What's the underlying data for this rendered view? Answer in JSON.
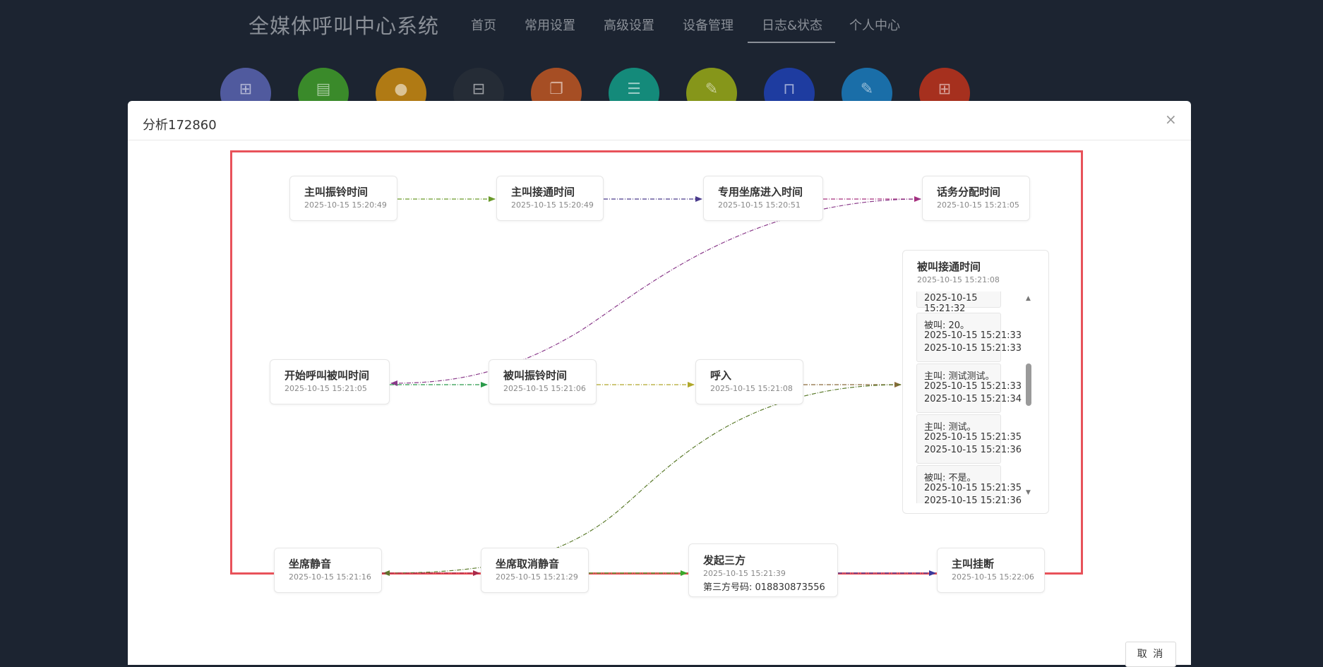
{
  "app": {
    "title": "全媒体呼叫中心系统",
    "nav": [
      "首页",
      "常用设置",
      "高级设置",
      "设备管理",
      "日志&状态",
      "个人中心"
    ],
    "active_nav": "日志&状态"
  },
  "quick_icons": [
    {
      "name": "stats-icon",
      "color": "#505a9e",
      "glyph": "⊞"
    },
    {
      "name": "document-icon",
      "color": "#3a8a2a",
      "glyph": "▤"
    },
    {
      "name": "user-icon",
      "color": "#b07a14",
      "glyph": "●"
    },
    {
      "name": "monitor-icon",
      "color": "#252c36",
      "glyph": "⊟"
    },
    {
      "name": "files-icon",
      "color": "#a64e24",
      "glyph": "❐"
    },
    {
      "name": "sliders-icon",
      "color": "#148a7a",
      "glyph": "☰"
    },
    {
      "name": "edit-icon",
      "color": "#86961a",
      "glyph": "✎"
    },
    {
      "name": "presentation-icon",
      "color": "#1e3ca0",
      "glyph": "⊓"
    },
    {
      "name": "write-icon",
      "color": "#1a6ea8",
      "glyph": "✎"
    },
    {
      "name": "report-icon",
      "color": "#a6301e",
      "glyph": "⊞"
    }
  ],
  "modal": {
    "title": "分析172860",
    "close_symbol": "×",
    "cancel_label": "取 消"
  },
  "flow": {
    "nodes": {
      "caller_ring": {
        "title": "主叫振铃时间",
        "time": "2025-10-15 15:20:49"
      },
      "caller_answer": {
        "title": "主叫接通时间",
        "time": "2025-10-15 15:20:49"
      },
      "agent_enter": {
        "title": "专用坐席进入时间",
        "time": "2025-10-15 15:20:51"
      },
      "dispatch": {
        "title": "话务分配时间",
        "time": "2025-10-15 15:21:05"
      },
      "start_callee": {
        "title": "开始呼叫被叫时间",
        "time": "2025-10-15 15:21:05"
      },
      "callee_ring": {
        "title": "被叫振铃时间",
        "time": "2025-10-15 15:21:06"
      },
      "incoming": {
        "title": "呼入",
        "time": "2025-10-15 15:21:08"
      },
      "agent_mute": {
        "title": "坐席静音",
        "time": "2025-10-15 15:21:16"
      },
      "agent_unmute": {
        "title": "坐席取消静音",
        "time": "2025-10-15 15:21:29"
      },
      "three_way": {
        "title": "发起三方",
        "time": "2025-10-15 15:21:39",
        "extra": "第三方号码: 018830873556"
      },
      "caller_hangup": {
        "title": "主叫挂断",
        "time": "2025-10-15 15:22:06"
      }
    },
    "callee_answer": {
      "title": "被叫接通时间",
      "time": "2025-10-15 15:21:08",
      "top_partial": "2025-10-15 15:21:32",
      "messages": [
        {
          "text": "被叫: 20。",
          "start": "2025-10-15 15:21:33",
          "end": "2025-10-15 15:21:33"
        },
        {
          "text": "主叫: 测试测试。",
          "start": "2025-10-15 15:21:33",
          "end": "2025-10-15 15:21:34"
        },
        {
          "text": "主叫: 测试。",
          "start": "2025-10-15 15:21:35",
          "end": "2025-10-15 15:21:36"
        },
        {
          "text": "被叫: 不是。",
          "start": "2025-10-15 15:21:35",
          "end": "2025-10-15 15:21:36"
        }
      ]
    },
    "edge_colors": {
      "ring_to_answer": "#6a9a2a",
      "answer_to_agent": "#4a3a8c",
      "agent_to_dispatch": "#a8307e",
      "dispatch_to_start": "#8a3a8a",
      "start_to_ring": "#2a9a4a",
      "ring_to_incoming": "#b0a82a",
      "incoming_to_callee": "#8a6a3a",
      "mute_to_callee": "#5a7a2a",
      "mute_to_unmute": "#a82a4a",
      "unmute_to_three": "#3aa82a",
      "three_to_hangup": "#3a3a9c"
    }
  }
}
